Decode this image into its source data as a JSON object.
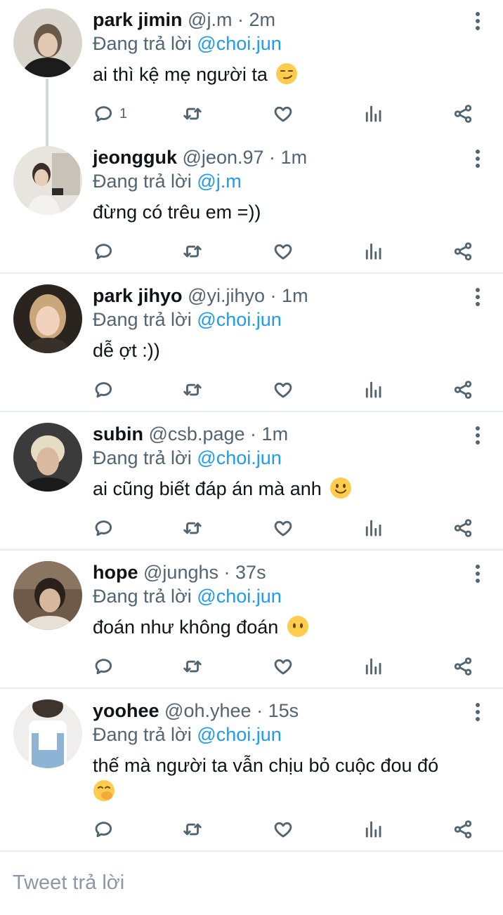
{
  "tweets": [
    {
      "name": "park jimin",
      "handle": "@j.m",
      "sep": "·",
      "time": "2m",
      "reply_prefix": "Đang trả lời",
      "reply_to": "@choi.jun",
      "text": "ai thì kệ mẹ người ta",
      "emoji": "smirk",
      "reply_count": "1"
    },
    {
      "name": "jeongguk",
      "handle": "@jeon.97",
      "sep": "·",
      "time": "1m",
      "reply_prefix": "Đang trả lời",
      "reply_to": "@j.m",
      "text": "đừng có trêu em =))",
      "emoji": "",
      "reply_count": ""
    },
    {
      "name": "park jihyo",
      "handle": "@yi.jihyo",
      "sep": "·",
      "time": "1m",
      "reply_prefix": "Đang trả lời",
      "reply_to": "@choi.jun",
      "text": "dễ ợt :))",
      "emoji": "",
      "reply_count": ""
    },
    {
      "name": "subin",
      "handle": "@csb.page",
      "sep": "·",
      "time": "1m",
      "reply_prefix": "Đang trả lời",
      "reply_to": "@choi.jun",
      "text": "ai cũng biết đáp án mà anh",
      "emoji": "smile",
      "reply_count": ""
    },
    {
      "name": "hope",
      "handle": "@junghs",
      "sep": "·",
      "time": "37s",
      "reply_prefix": "Đang trả lời",
      "reply_to": "@choi.jun",
      "text": "đoán như không đoán",
      "emoji": "no-mouth",
      "reply_count": ""
    },
    {
      "name": "yoohee",
      "handle": "@oh.yhee",
      "sep": "·",
      "time": "15s",
      "reply_prefix": "Đang trả lời",
      "reply_to": "@choi.jun",
      "text": "thế mà người ta vẫn chịu bỏ cuộc đou đó",
      "emoji": "hand-over-mouth",
      "reply_count": ""
    }
  ],
  "composer": {
    "placeholder": "Tweet trả lời"
  },
  "colors": {
    "accent": "#1d9bf0",
    "text": "#0f1419",
    "muted": "#536471",
    "divider": "#e6ecf0",
    "thread_line": "#cfd9de"
  }
}
